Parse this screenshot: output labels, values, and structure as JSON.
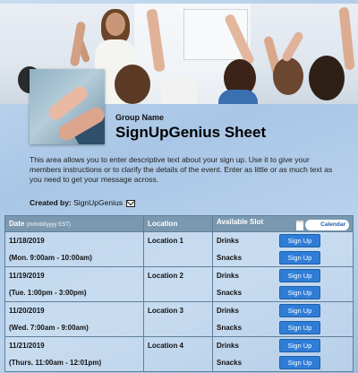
{
  "header": {
    "group_name": "Group Name",
    "title": "SignUpGenius Sheet"
  },
  "description": "This area allows you to enter descriptive text about your sign up. Use it to give your members instructions or to clarify the details of the event. Enter as little or as much text as you need to get your message across.",
  "created_by": {
    "label": "Created by:",
    "name": "SignUpGenius"
  },
  "table": {
    "headers": {
      "date": "Date",
      "date_format": "(mm/dd/yyyy EST)",
      "location": "Location",
      "slot": "Available Slot",
      "calendar": "Calendar"
    },
    "rows": [
      {
        "date": "11/18/2019",
        "time": "(Mon. 9:00am - 10:00am)",
        "location": "Location 1",
        "slots": [
          {
            "name": "Drinks",
            "button": "Sign Up"
          },
          {
            "name": "Snacks",
            "button": "Sign Up"
          }
        ]
      },
      {
        "date": "11/19/2019",
        "time": "(Tue. 1:00pm - 3:00pm)",
        "location": "Location 2",
        "slots": [
          {
            "name": "Drinks",
            "button": "Sign Up"
          },
          {
            "name": "Snacks",
            "button": "Sign Up"
          }
        ]
      },
      {
        "date": "11/20/2019",
        "time": "(Wed. 7:00am - 9:00am)",
        "location": "Location 3",
        "slots": [
          {
            "name": "Drinks",
            "button": "Sign Up"
          },
          {
            "name": "Snacks",
            "button": "Sign Up"
          }
        ]
      },
      {
        "date": "11/21/2019",
        "time": "(Thurs. 11:00am - 12:01pm)",
        "location": "Location 4",
        "slots": [
          {
            "name": "Drinks",
            "button": "Sign Up"
          },
          {
            "name": "Snacks",
            "button": "Sign Up"
          }
        ]
      }
    ]
  },
  "colors": {
    "table_header": "#7a98b0",
    "signup_button": "#2f7dd6",
    "background": "#b9d2ec"
  },
  "icons": {
    "mail": "envelope-icon",
    "calendar": "calendar-icon"
  }
}
